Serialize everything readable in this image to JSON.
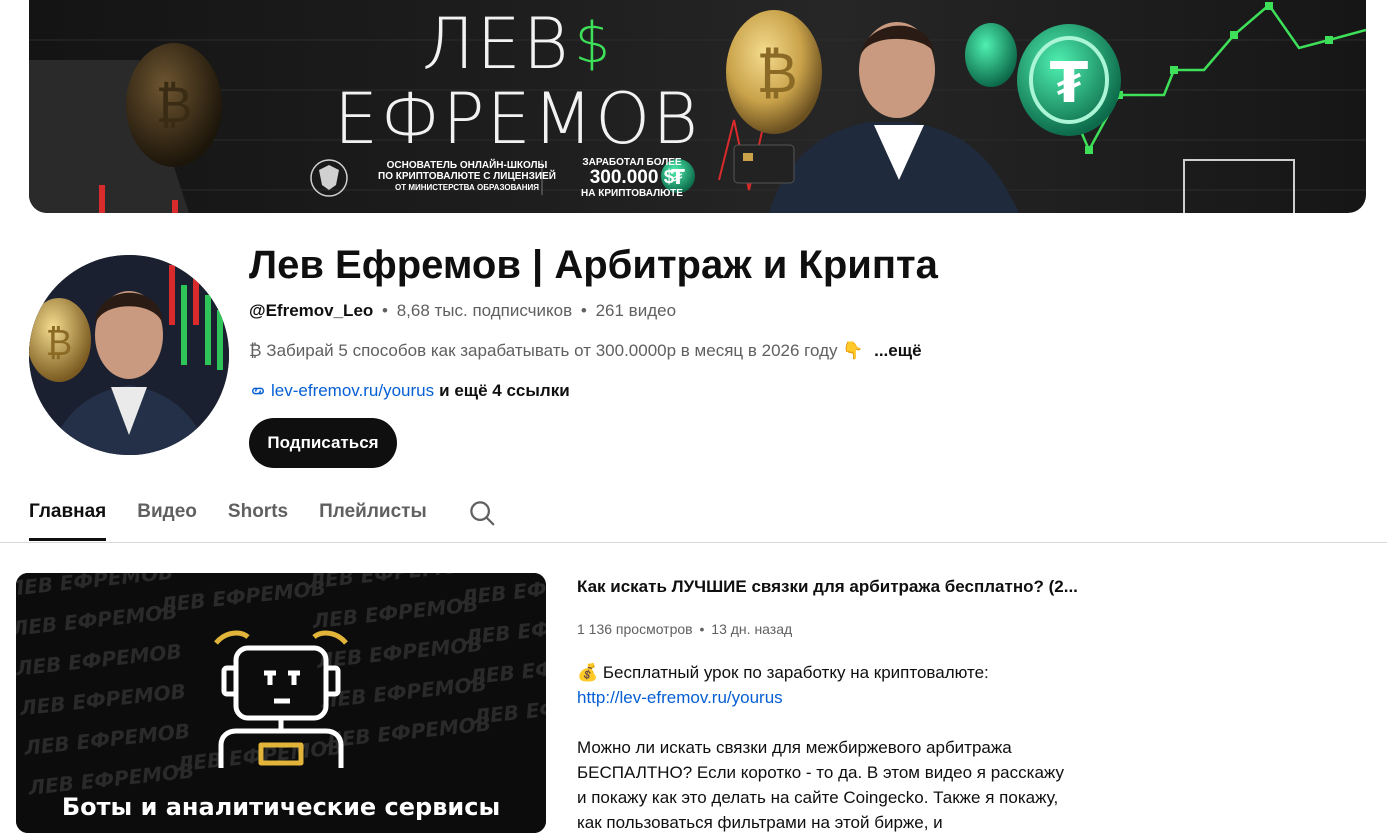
{
  "banner": {
    "title_line1": "ЛЕВ",
    "title_dollar": "$",
    "title_line2": "ЕФРЕМОВ",
    "sub1_line1": "ОСНОВАТЕЛЬ ОНЛАЙН-ШКОЛЫ",
    "sub1_line2": "ПО КРИПТОВАЛЮТЕ С ЛИЦЕНЗИЕЙ",
    "sub1_line3": "ОТ МИНИСТЕРСТВА ОБРАЗОВАНИЯ",
    "sub2_top": "ЗАРАБОТАЛ БОЛЕЕ",
    "sub2_num": "300.000 $",
    "sub2_bot": "НА КРИПТОВАЛЮТЕ",
    "colors": {
      "accent_green": "#3ee05a",
      "tether_green": "#1aa37a",
      "bitcoin_gold": "#c9a24a"
    }
  },
  "channel": {
    "title": "Лев Ефремов | Арбитраж и Крипта",
    "handle": "@Efremov_Leo",
    "sep": "•",
    "subscribers": "8,68 тыс. подписчиков",
    "videos": "261 видео",
    "description": "₿ Забирай 5 способов как зарабатывать от 300.0000р в месяц в 2026 году 👇",
    "description_more": "...ещё",
    "link": "lev-efremov.ru/yourus",
    "more_links": "и ещё 4 ссылки",
    "subscribe_label": "Подписаться"
  },
  "tabs": [
    {
      "label": "Главная",
      "active": true
    },
    {
      "label": "Видео",
      "active": false
    },
    {
      "label": "Shorts",
      "active": false
    },
    {
      "label": "Плейлисты",
      "active": false
    }
  ],
  "tab_search_icon": "search-icon",
  "featured": {
    "thumbnail_pattern_text": "ЛЕВ ЕФРЕМОВ",
    "thumbnail_caption": "Боты и аналитические сервисы",
    "title": "Как искать ЛУЧШИЕ связки для арбитража бесплатно? (2...",
    "views": "1 136 просмотров",
    "sep": "•",
    "age": "13 дн. назад",
    "desc_line1": "💰 Бесплатный урок по заработку на криптовалюте:",
    "desc_link": "http://lev-efremov.ru/yourus",
    "desc_para": "Можно ли искать связки для межбиржевого арбитража БЕСПАЛТНО? Если коротко - то да. В этом видео я расскажу и покажу как это делать на сайте Coingecko. Также я покажу, как пользоваться фильтрами на этой бирже, и"
  }
}
